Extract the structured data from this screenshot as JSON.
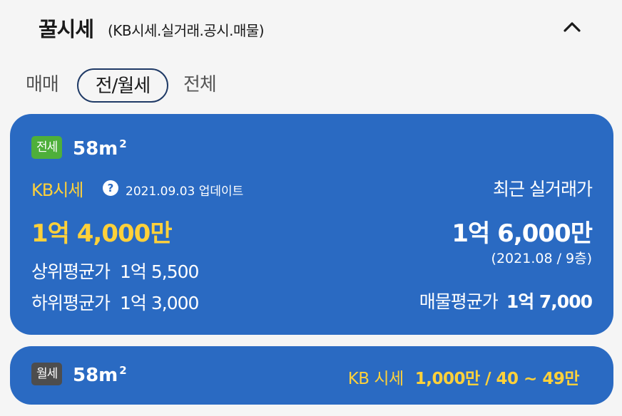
{
  "header": {
    "title": "꿀시세",
    "subtitle": "(KB시세.실거래.공시.매물)"
  },
  "tabs": [
    {
      "label": "매매"
    },
    {
      "label": "전/월세"
    },
    {
      "label": "전체"
    }
  ],
  "active_tab": "전/월세",
  "jeonse_card": {
    "badge": "전세",
    "area": "58m",
    "area_sup": "2",
    "kb_label": "KB시세",
    "help_icon": "?",
    "update_text": "2021.09.03 업데이트",
    "kb_price": "1억 4,000만",
    "upper_label": "상위평균가",
    "upper_value": "1억 5,500",
    "lower_label": "하위평균가",
    "lower_value": "1억 3,000",
    "recent_label": "최근 실거래가",
    "recent_price": "1억 6,000만",
    "recent_date": "(2021.08 / 9층)",
    "listing_label": "매물평균가",
    "listing_value": "1억 7,000"
  },
  "wolse_card": {
    "badge": "월세",
    "area": "58m",
    "area_sup": "2",
    "kb_label": "KB 시세",
    "kb_value": "1,000만 / 40 ~ 49만"
  },
  "colors": {
    "card_bg": "#2a6ac2",
    "accent_yellow": "#ffd13a",
    "jeonse_badge": "#4eaf3a",
    "wolse_badge": "#4d4d4d",
    "tab_border": "#1f3a66"
  },
  "icons": {
    "collapse": "chevron-up-icon",
    "help": "question-circle-icon"
  }
}
